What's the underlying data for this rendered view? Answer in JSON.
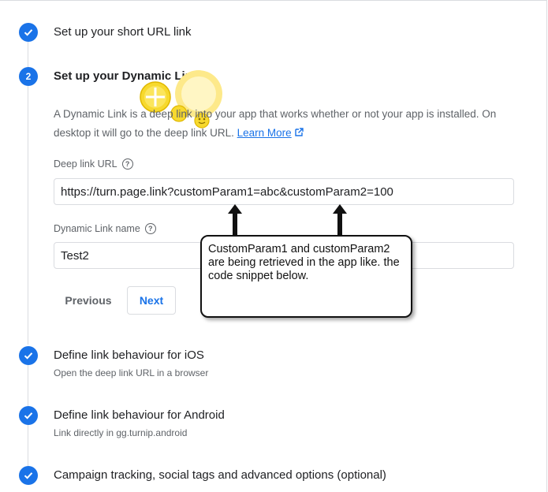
{
  "steps": [
    {
      "title": "Set up your short URL link"
    },
    {
      "number": "2",
      "title": "Set up your Dynamic Link"
    },
    {
      "title": "Define link behaviour for iOS",
      "subtitle": "Open the deep link URL in a browser"
    },
    {
      "title": "Define link behaviour for Android",
      "subtitle": "Link directly in gg.turnip.android"
    },
    {
      "title": "Campaign tracking, social tags and advanced options (optional)"
    }
  ],
  "dynamic_link": {
    "description": "A Dynamic Link is a deep link into your app that works whether or not your app is installed. On desktop it will go to the deep link URL.",
    "learn_more": "Learn More",
    "deep_link_label": "Deep link URL",
    "deep_link_value": "https://turn.page.link?customParam1=abc&customParam2=100",
    "name_label": "Dynamic Link name",
    "name_value": "Test2",
    "previous_label": "Previous",
    "next_label": "Next"
  },
  "annotation": {
    "text": "CustomParam1 and customParam2 are being retrieved in the app like. the code snippet below."
  },
  "colors": {
    "accent": "#1a73e8",
    "muted": "#5f6368",
    "border": "#dadce0"
  }
}
